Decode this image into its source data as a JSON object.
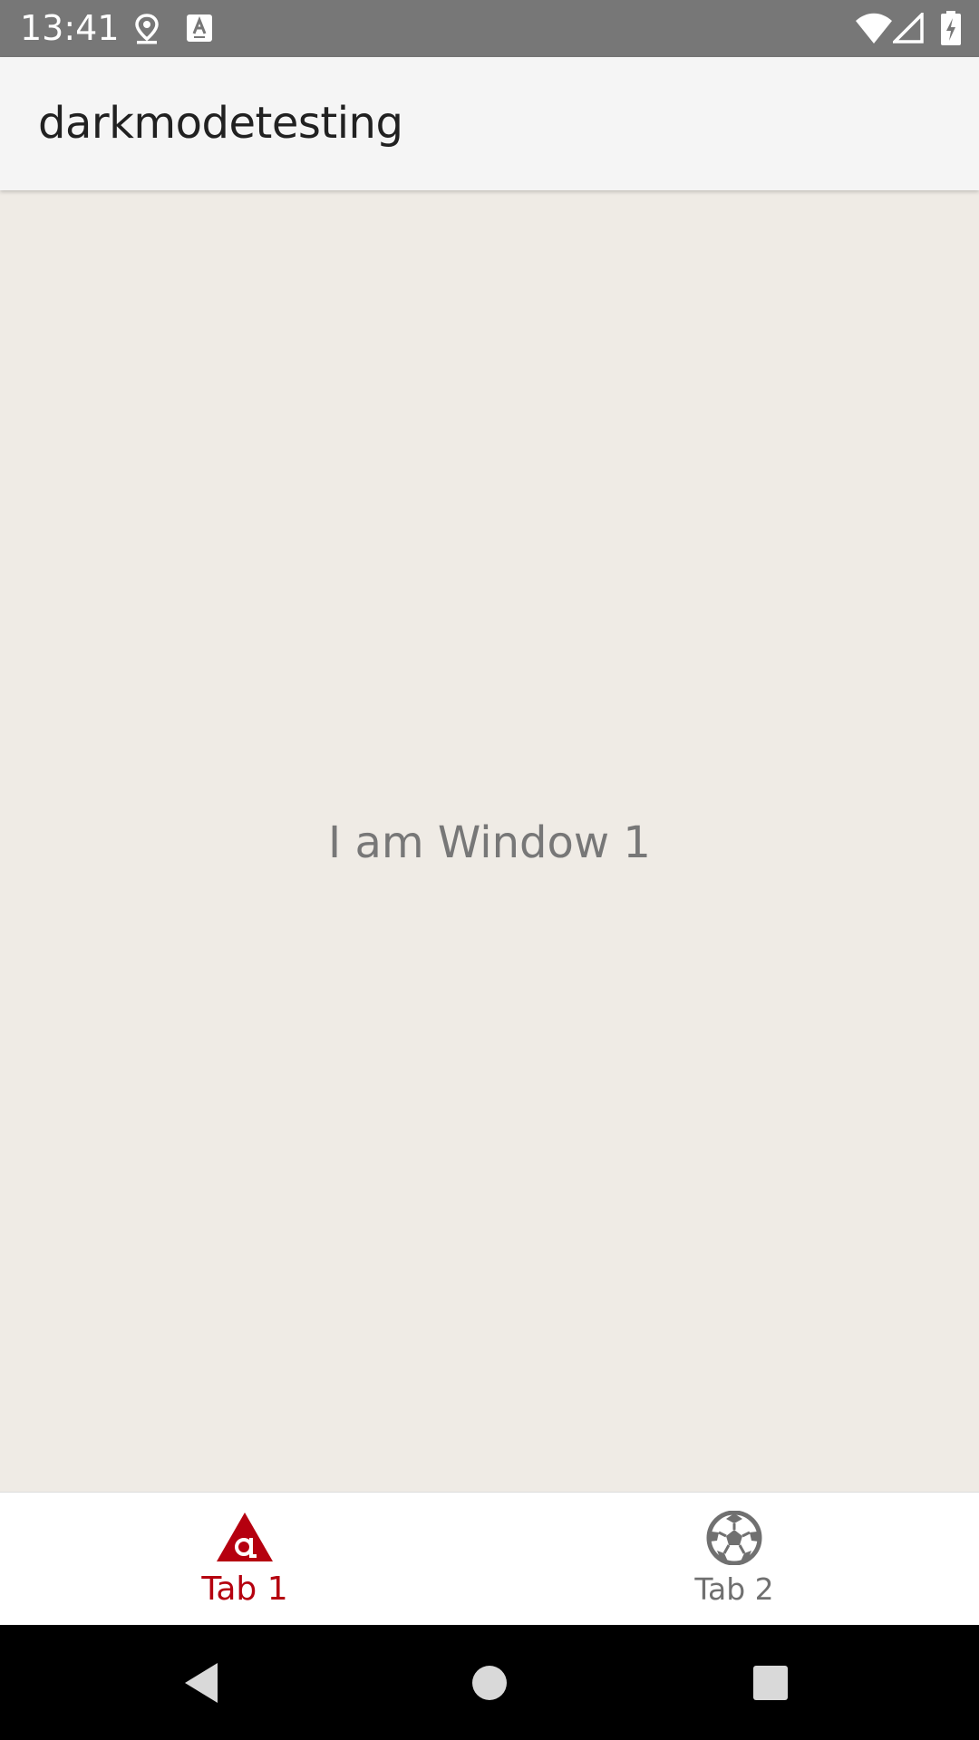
{
  "status_bar": {
    "time": "13:41",
    "icons": [
      "location-icon",
      "keyboard-a-icon",
      "wifi-icon",
      "cellular-signal-icon",
      "battery-charging-icon"
    ]
  },
  "app_bar": {
    "title": "darkmodetesting"
  },
  "content": {
    "window_label": "I am Window 1"
  },
  "tabs": [
    {
      "label": "Tab 1",
      "icon": "appcelerator-logo-icon",
      "selected": true
    },
    {
      "label": "Tab 2",
      "icon": "soccer-ball-icon",
      "selected": false
    }
  ],
  "nav_bar": {
    "buttons": [
      "back-icon",
      "home-icon",
      "recents-icon"
    ]
  },
  "colors": {
    "status_bar": "#777777",
    "app_bar": "#f5f5f5",
    "content_background": "#efebe5",
    "accent": "#b5000f",
    "inactive_tab": "#707070",
    "nav_bar": "#000000"
  }
}
